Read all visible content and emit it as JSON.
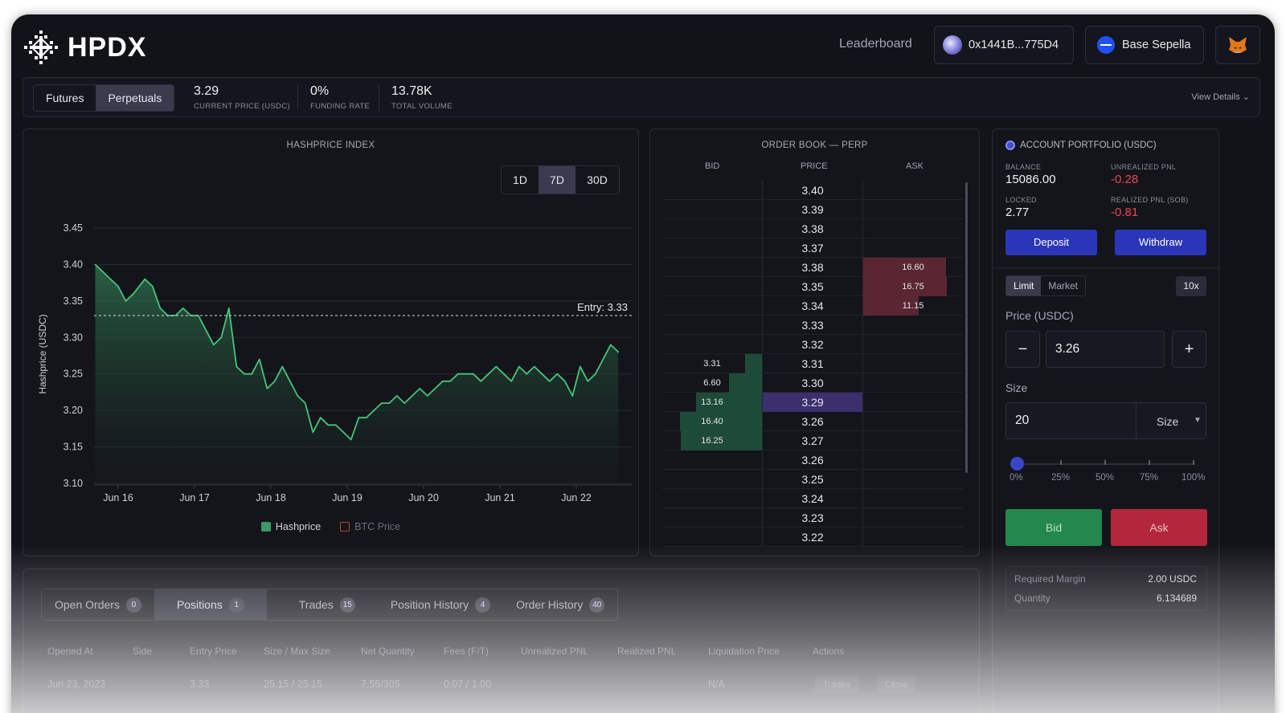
{
  "header": {
    "logo_text": "HPDX",
    "nav_leaderboard": "Leaderboard",
    "wallet_address": "0x1441B...775D4",
    "network_name": "Base Sepella"
  },
  "stats": {
    "mode_futures": "Futures",
    "mode_perpetuals": "Perpetuals",
    "active_mode": "Perpetuals",
    "current_price": "3.29",
    "current_price_label": "CURRENT PRICE (USDC)",
    "funding_rate": "0%",
    "funding_rate_label": "FUNDING RATE",
    "total_volume": "13.78K",
    "total_volume_label": "TOTAL VOLUME",
    "view_details": "View Details"
  },
  "chart": {
    "title": "HASHPRICE INDEX",
    "ranges": [
      "1D",
      "7D",
      "30D"
    ],
    "active_range": "7D",
    "entry_label": "Entry: 3.33",
    "legend_hashprice": "Hashprice",
    "legend_btc": "BTC Price"
  },
  "chart_data": {
    "type": "area",
    "title": "HASHPRICE INDEX",
    "xlabel": "",
    "ylabel": "Hashprice (USDC)",
    "ylim": [
      3.1,
      3.45
    ],
    "yticks": [
      "3.45",
      "3.40",
      "3.35",
      "3.30",
      "3.25",
      "3.20",
      "3.15",
      "3.10"
    ],
    "xticks": [
      "Jun 16",
      "Jun 17",
      "Jun 18",
      "Jun 19",
      "Jun 20",
      "Jun 21",
      "Jun 22"
    ],
    "xlim": [
      0,
      6.8
    ],
    "entry_price": 3.33,
    "grid": true,
    "legend_position": "bottom",
    "colors": {
      "hashprice": "#46c47a",
      "btc": "#b8482a"
    },
    "series": [
      {
        "name": "Hashprice",
        "x": [
          -0.3,
          -0.2,
          -0.1,
          0.0,
          0.1,
          0.2,
          0.35,
          0.45,
          0.55,
          0.65,
          0.75,
          0.85,
          0.95,
          1.05,
          1.15,
          1.25,
          1.35,
          1.45,
          1.55,
          1.65,
          1.75,
          1.85,
          1.95,
          2.05,
          2.15,
          2.25,
          2.35,
          2.45,
          2.55,
          2.65,
          2.75,
          2.85,
          2.95,
          3.05,
          3.15,
          3.25,
          3.35,
          3.45,
          3.55,
          3.65,
          3.75,
          3.85,
          3.95,
          4.05,
          4.15,
          4.25,
          4.35,
          4.45,
          4.55,
          4.65,
          4.75,
          4.85,
          4.95,
          5.05,
          5.15,
          5.25,
          5.35,
          5.45,
          5.55,
          5.65,
          5.75,
          5.85,
          5.95,
          6.05,
          6.15,
          6.25,
          6.35,
          6.45,
          6.55
        ],
        "values": [
          3.4,
          3.39,
          3.38,
          3.37,
          3.35,
          3.36,
          3.38,
          3.37,
          3.34,
          3.33,
          3.33,
          3.34,
          3.33,
          3.33,
          3.31,
          3.29,
          3.3,
          3.34,
          3.26,
          3.25,
          3.25,
          3.27,
          3.23,
          3.24,
          3.26,
          3.24,
          3.22,
          3.21,
          3.17,
          3.19,
          3.18,
          3.18,
          3.17,
          3.16,
          3.19,
          3.19,
          3.2,
          3.21,
          3.21,
          3.22,
          3.21,
          3.22,
          3.23,
          3.22,
          3.23,
          3.24,
          3.24,
          3.25,
          3.25,
          3.25,
          3.24,
          3.25,
          3.26,
          3.25,
          3.24,
          3.26,
          3.25,
          3.26,
          3.25,
          3.24,
          3.25,
          3.24,
          3.22,
          3.26,
          3.24,
          3.25,
          3.27,
          3.29,
          3.28
        ]
      },
      {
        "name": "BTC Price",
        "x": [],
        "values": []
      }
    ]
  },
  "order_book": {
    "title": "ORDER BOOK — PERP",
    "col_bid": "BID",
    "col_price": "PRICE",
    "col_ask": "ASK",
    "max_size": 20,
    "rows": [
      {
        "price": "3.40",
        "bid": "",
        "ask": "",
        "bid_size": 0,
        "ask_size": 0,
        "current": false
      },
      {
        "price": "3.39",
        "bid": "",
        "ask": "",
        "bid_size": 0,
        "ask_size": 0,
        "current": false
      },
      {
        "price": "3.38",
        "bid": "",
        "ask": "",
        "bid_size": 0,
        "ask_size": 0,
        "current": false
      },
      {
        "price": "3.37",
        "bid": "",
        "ask": "",
        "bid_size": 0,
        "ask_size": 0,
        "current": false
      },
      {
        "price": "3.38",
        "bid": "",
        "ask": "16.60",
        "bid_size": 0,
        "ask_size": 16.6,
        "current": false
      },
      {
        "price": "3.35",
        "bid": "",
        "ask": "16.75",
        "bid_size": 0,
        "ask_size": 16.75,
        "current": false
      },
      {
        "price": "3.34",
        "bid": "",
        "ask": "11.15",
        "bid_size": 0,
        "ask_size": 11.15,
        "current": false
      },
      {
        "price": "3.33",
        "bid": "",
        "ask": "",
        "bid_size": 0,
        "ask_size": 0,
        "current": false
      },
      {
        "price": "3.32",
        "bid": "",
        "ask": "",
        "bid_size": 0,
        "ask_size": 0,
        "current": false
      },
      {
        "price": "3.31",
        "bid": "3.31",
        "ask": "",
        "bid_size": 3.31,
        "ask_size": 0,
        "current": false
      },
      {
        "price": "3.30",
        "bid": "6.60",
        "ask": "",
        "bid_size": 6.6,
        "ask_size": 0,
        "current": false
      },
      {
        "price": "3.29",
        "bid": "13.16",
        "ask": "",
        "bid_size": 13.16,
        "ask_size": 0,
        "current": true
      },
      {
        "price": "3.26",
        "bid": "16.40",
        "ask": "",
        "bid_size": 16.4,
        "ask_size": 0,
        "current": false
      },
      {
        "price": "3.27",
        "bid": "16.25",
        "ask": "",
        "bid_size": 16.25,
        "ask_size": 0,
        "current": false
      },
      {
        "price": "3.26",
        "bid": "",
        "ask": "",
        "bid_size": 0,
        "ask_size": 0,
        "current": false
      },
      {
        "price": "3.25",
        "bid": "",
        "ask": "",
        "bid_size": 0,
        "ask_size": 0,
        "current": false
      },
      {
        "price": "3.24",
        "bid": "",
        "ask": "",
        "bid_size": 0,
        "ask_size": 0,
        "current": false
      },
      {
        "price": "3.23",
        "bid": "",
        "ask": "",
        "bid_size": 0,
        "ask_size": 0,
        "current": false
      },
      {
        "price": "3.22",
        "bid": "",
        "ask": "",
        "bid_size": 0,
        "ask_size": 0,
        "current": false
      }
    ]
  },
  "portfolio": {
    "title": "ACCOUNT PORTFOLIO (USDC)",
    "balance_label": "BALANCE",
    "balance": "15086.00",
    "unrealized_label": "UNREALIZED PNL",
    "unrealized": "-0.28",
    "locked_label": "LOCKED",
    "locked": "2.77",
    "realized_label": "REALIZED PNL (SOB)",
    "realized": "-0.81",
    "deposit": "Deposit",
    "withdraw": "Withdraw",
    "order_limit": "Limit",
    "order_market": "Market",
    "active_order_type": "Limit",
    "leverage": "10x",
    "price_label": "Price (USDC)",
    "price_minus": "−",
    "price_value": "3.26",
    "price_plus": "+",
    "size_label": "Size",
    "size_value": "20",
    "size_unit": "Size",
    "size_percent": 0,
    "slider_marks": [
      "0%",
      "25%",
      "50%",
      "75%",
      "100%"
    ],
    "bid": "Bid",
    "ask": "Ask",
    "required_margin_label": "Required Margin",
    "required_margin": "2.00 USDC",
    "quantity_label": "Quantity",
    "quantity": "6.134689"
  },
  "positions": {
    "tabs": [
      {
        "label": "Open Orders",
        "count": "0"
      },
      {
        "label": "Positions",
        "count": "1"
      },
      {
        "label": "Trades",
        "count": "15"
      },
      {
        "label": "Position History",
        "count": "4"
      },
      {
        "label": "Order History",
        "count": "40"
      }
    ],
    "active_tab": "Positions",
    "columns": [
      "Opened At",
      "Side",
      "Entry Price",
      "Size / Max Size",
      "Net Quantity",
      "Fees (F/T)",
      "Unrealized PNL",
      "Realized PNL",
      "Liquidation Price",
      "Actions"
    ],
    "row": {
      "opened_at": "Jun 23, 2023",
      "entry_price": "3.33",
      "size": "25.15 / 25.15",
      "net_quantity": "7.55/305",
      "fees": "0.07 / 1.00",
      "liquidation": "N/A",
      "action_1": "Trades",
      "action_2": "Close"
    }
  }
}
